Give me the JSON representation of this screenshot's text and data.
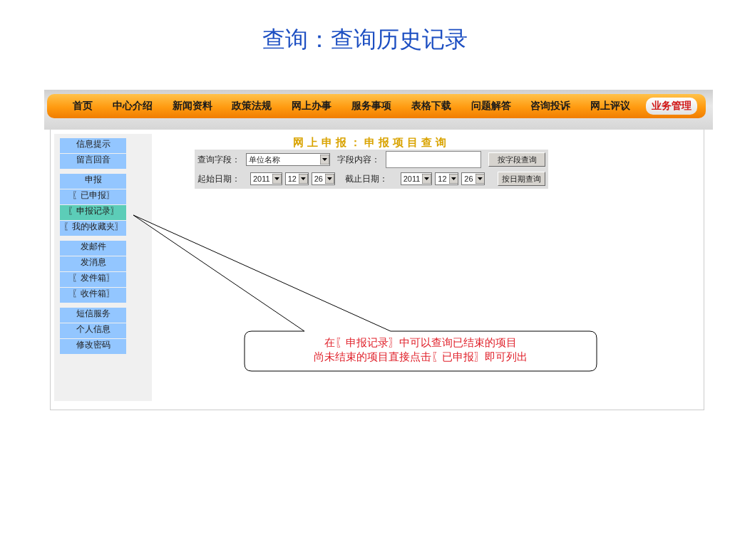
{
  "title": "查询：查询历史记录",
  "nav": {
    "items": [
      {
        "label": "首页",
        "selected": false
      },
      {
        "label": "中心介绍",
        "selected": false
      },
      {
        "label": "新闻资料",
        "selected": false
      },
      {
        "label": "政策法规",
        "selected": false
      },
      {
        "label": "网上办事",
        "selected": false
      },
      {
        "label": "服务事项",
        "selected": false
      },
      {
        "label": "表格下载",
        "selected": false
      },
      {
        "label": "问题解答",
        "selected": false
      },
      {
        "label": "咨询投诉",
        "selected": false
      },
      {
        "label": "网上评议",
        "selected": false
      },
      {
        "label": "业务管理",
        "selected": true
      }
    ]
  },
  "sidebar": {
    "groups": [
      [
        {
          "label": "信息提示",
          "selected": false
        },
        {
          "label": "留言回音",
          "selected": false
        }
      ],
      [
        {
          "label": "申报",
          "selected": false
        },
        {
          "label": "〖已申报〗",
          "selected": false
        },
        {
          "label": "〖申报记录〗",
          "selected": true
        },
        {
          "label": "〖我的收藏夹〗",
          "selected": false
        }
      ],
      [
        {
          "label": "发邮件",
          "selected": false
        },
        {
          "label": "发消息",
          "selected": false
        },
        {
          "label": "〖发件箱〗",
          "selected": false
        },
        {
          "label": "〖收件箱〗",
          "selected": false
        }
      ],
      [
        {
          "label": "短信服务",
          "selected": false
        },
        {
          "label": "个人信息",
          "selected": false
        },
        {
          "label": "修改密码",
          "selected": false
        }
      ]
    ]
  },
  "form": {
    "heading": "网上申报：申报项目查询",
    "field_label": "查询字段：",
    "field_select": "单位名称",
    "content_label": "字段内容：",
    "field_button": "按字段查询",
    "start_label": "起始日期：",
    "start_date": [
      "2011",
      "12",
      "26"
    ],
    "end_label": "截止日期：",
    "end_date": [
      "2011",
      "12",
      "26"
    ],
    "date_button": "按日期查询"
  },
  "callout": {
    "lines": [
      "在〖申报记录〗中可以查询已结束的项目",
      "尚未结束的项目直接点击〖已申报〗即可列出"
    ]
  }
}
